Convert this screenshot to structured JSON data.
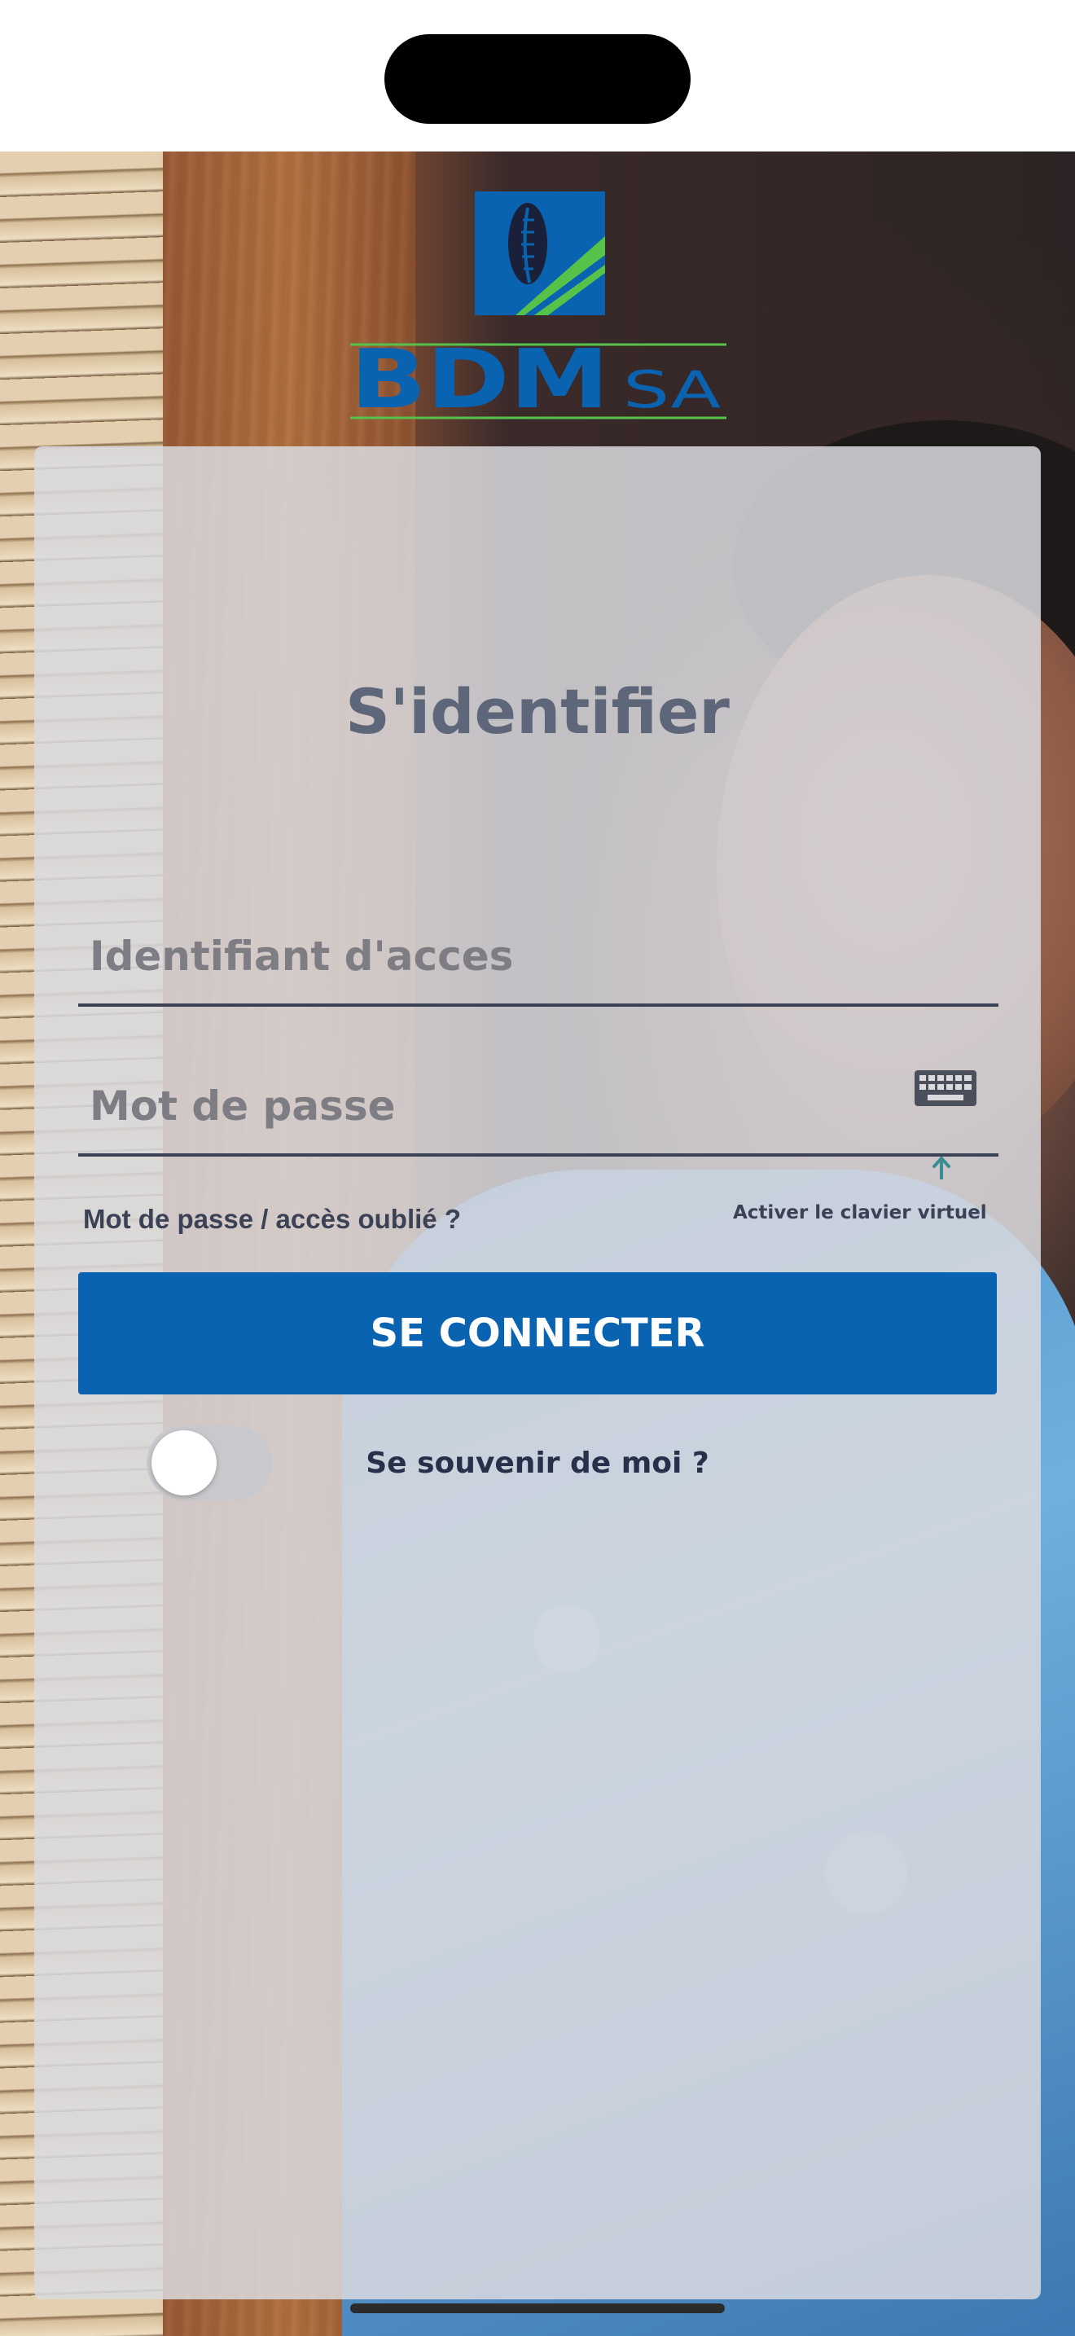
{
  "brand": {
    "name": "BDM",
    "suffix": "SA",
    "primary_color": "#0a63b1",
    "accent_color": "#57c24a"
  },
  "login": {
    "title": "S'identifier",
    "username_placeholder": "Identifiant d'acces",
    "password_placeholder": "Mot de passe",
    "forgot_link": "Mot de passe / accès oublié ?",
    "virtual_keyboard_label": "Activer le clavier virtuel",
    "submit_label": "SE CONNECTER",
    "remember_label": "Se souvenir de moi ?",
    "remember_enabled": false
  },
  "icons": {
    "keyboard": "keyboard-icon",
    "arrow_up": "arrow-up-icon",
    "logo_mark": "cowrie-shell-icon"
  }
}
